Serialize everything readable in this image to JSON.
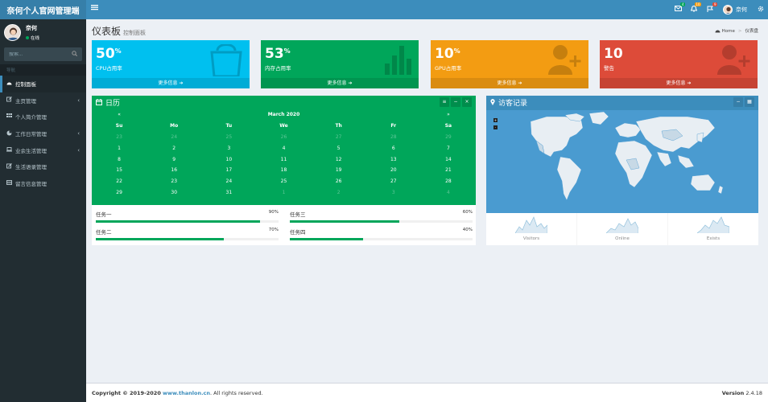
{
  "app": {
    "logo": "奈何个人官网管理端"
  },
  "topbar": {
    "toggle_icon": "bars-icon",
    "mail_badge": "4",
    "bell_badge": "10",
    "flag_badge": "9",
    "user_name": "奈何"
  },
  "sidebar": {
    "user_name": "奈何",
    "status": "在线",
    "search_placeholder": "搜索...",
    "header": "导航",
    "items": [
      {
        "label": "控制面板",
        "icon": "dashboard-icon"
      },
      {
        "label": "主页管理",
        "icon": "edit-icon"
      },
      {
        "label": "个人简介管理",
        "icon": "list-icon"
      },
      {
        "label": "工作日常管理",
        "icon": "pie-chart-icon"
      },
      {
        "label": "业余生活管理",
        "icon": "laptop-icon"
      },
      {
        "label": "生活语录管理",
        "icon": "pencil-icon"
      },
      {
        "label": "留言信息管理",
        "icon": "table-icon"
      }
    ]
  },
  "content": {
    "title": "仪表板",
    "subtitle": "控制面板",
    "breadcrumb_home": "Home",
    "breadcrumb_current": "仪表盘"
  },
  "stats": [
    {
      "value": "50",
      "suffix": "%",
      "label": "CPU占用率",
      "more": "更多信息",
      "color": "#00c0ef",
      "icon": "shopping-bag-icon"
    },
    {
      "value": "53",
      "suffix": "%",
      "label": "内存占用率",
      "more": "更多信息",
      "color": "#00a65a",
      "icon": "bar-chart-icon"
    },
    {
      "value": "10",
      "suffix": "%",
      "label": "GPU占用率",
      "more": "更多信息",
      "color": "#f39c12",
      "icon": "user-plus-icon"
    },
    {
      "value": "10",
      "suffix": "",
      "label": "警告",
      "more": "更多信息",
      "color": "#dd4b39",
      "icon": "user-plus-icon"
    }
  ],
  "calendar": {
    "title": "日历",
    "prev": "«",
    "next": "»",
    "month": "March 2020",
    "weekdays": [
      "Su",
      "Mo",
      "Tu",
      "We",
      "Th",
      "Fr",
      "Sa"
    ],
    "weeks": [
      [
        "23",
        "24",
        "25",
        "26",
        "27",
        "28",
        "29"
      ],
      [
        "1",
        "2",
        "3",
        "4",
        "5",
        "6",
        "7"
      ],
      [
        "8",
        "9",
        "10",
        "11",
        "12",
        "13",
        "14"
      ],
      [
        "15",
        "16",
        "17",
        "18",
        "19",
        "20",
        "21"
      ],
      [
        "22",
        "23",
        "24",
        "25",
        "26",
        "27",
        "28"
      ],
      [
        "29",
        "30",
        "31",
        "1",
        "2",
        "3",
        "4"
      ]
    ]
  },
  "tasks": [
    {
      "label": "任务一",
      "percent": "90%",
      "value": 90
    },
    {
      "label": "任务三",
      "percent": "60%",
      "value": 60
    },
    {
      "label": "任务二",
      "percent": "70%",
      "value": 70
    },
    {
      "label": "任务四",
      "percent": "40%",
      "value": 40
    }
  ],
  "visitors": {
    "title": "访客记录",
    "zoom_in": "+",
    "zoom_out": "-",
    "stats": [
      "Visitors",
      "Online",
      "Exists"
    ]
  },
  "footer": {
    "copyright": "Copyright © 2019-2020",
    "link": "www.thanlon.cn",
    "rights": ". All rights reserved.",
    "version_label": "Version",
    "version": "2.4.18"
  }
}
